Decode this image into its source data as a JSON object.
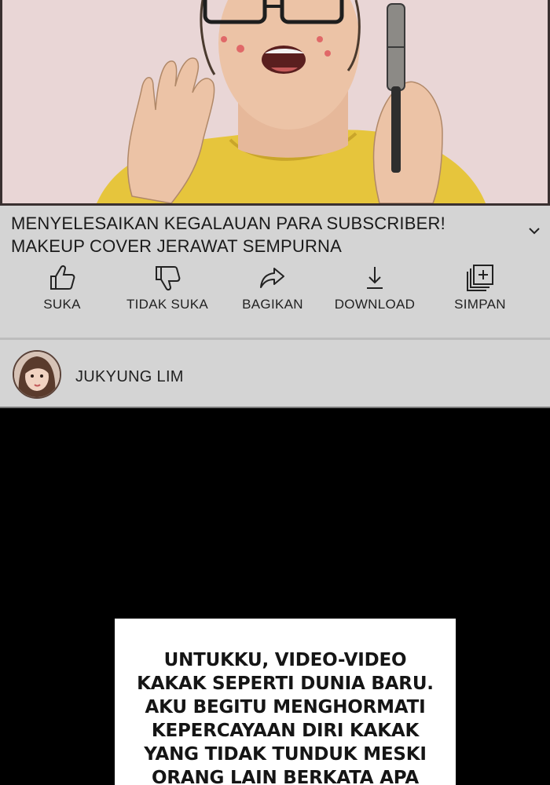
{
  "video": {
    "colors": {
      "background": "#e9d6d6",
      "shirt": "#e8c73a",
      "skin": "#e9bfa1"
    }
  },
  "title": {
    "line1": "MENYELESAIKAN KEGALAUAN PARA SUBSCRIBER!",
    "line2": "MAKEUP COVER JERAWAT SEMPURNA",
    "expand_icon": "chevron-down-icon"
  },
  "actions": [
    {
      "label": "SUKA",
      "icon": "thumbs-up-icon"
    },
    {
      "label": "TIDAK SUKA",
      "icon": "thumbs-down-icon"
    },
    {
      "label": "BAGIKAN",
      "icon": "share-icon"
    },
    {
      "label": "DOWNLOAD",
      "icon": "download-icon"
    },
    {
      "label": "SIMPAN",
      "icon": "add-to-playlist-icon"
    }
  ],
  "channel": {
    "name": "JUKYUNG LIM",
    "avatar_icon": "avatar"
  },
  "caption": {
    "lines": [
      "UNTUKKU, VIDEO-VIDEO",
      "KAKAK SEPERTI DUNIA BARU.",
      "AKU BEGITU MENGHORMATI",
      "KEPERCAYAAN DIRI KAKAK",
      "YANG TIDAK TUNDUK MESKI",
      "ORANG LAIN BERKATA APA"
    ]
  }
}
